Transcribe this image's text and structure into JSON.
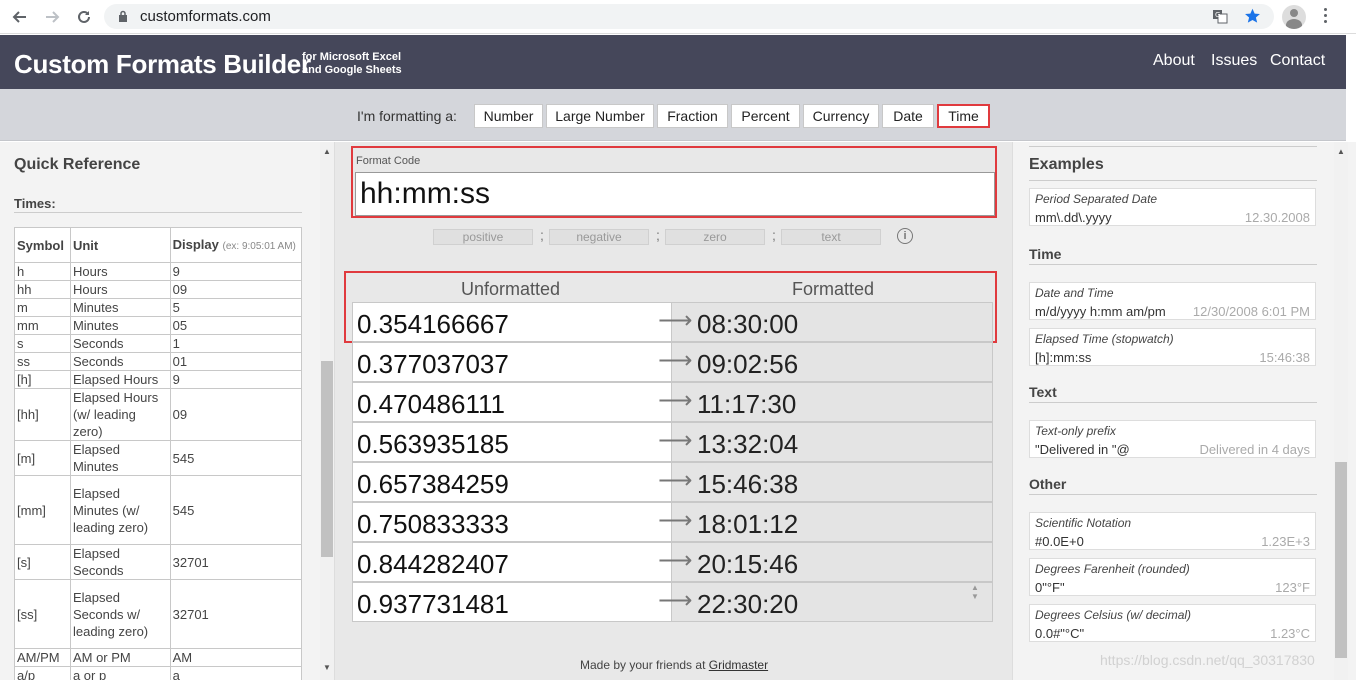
{
  "browser": {
    "url": "customformats.com",
    "icons": {
      "back": "back-arrow-icon",
      "forward": "forward-arrow-icon",
      "reload": "reload-icon",
      "lock": "lock-icon",
      "translate": "translate-icon",
      "bookmark": "star-icon",
      "profile": "avatar-icon",
      "menu": "kebab-menu-icon"
    }
  },
  "header": {
    "brand": "Custom Formats Builder",
    "subtitle_line1": "for Microsoft Excel",
    "subtitle_line2": "and Google Sheets",
    "nav": [
      "About",
      "Issues",
      "Contact"
    ]
  },
  "type_bar": {
    "label": "I'm formatting a:",
    "options": [
      "Number",
      "Large Number",
      "Fraction",
      "Percent",
      "Currency",
      "Date",
      "Time"
    ],
    "selected": "Time"
  },
  "quick_reference": {
    "title": "Quick Reference",
    "section": "Times:",
    "columns": [
      "Symbol",
      "Unit",
      "Display"
    ],
    "display_hint": "(ex: 9:05:01 AM)",
    "rows": [
      [
        "h",
        "Hours",
        "9"
      ],
      [
        "hh",
        "Hours",
        "09"
      ],
      [
        "m",
        "Minutes",
        "5"
      ],
      [
        "mm",
        "Minutes",
        "05"
      ],
      [
        "s",
        "Seconds",
        "1"
      ],
      [
        "ss",
        "Seconds",
        "01"
      ],
      [
        "[h]",
        "Elapsed Hours",
        "9"
      ],
      [
        "[hh]",
        "Elapsed Hours (w/ leading zero)",
        "09"
      ],
      [
        "[m]",
        "Elapsed Minutes",
        "545"
      ],
      [
        "[mm]",
        "Elapsed Minutes (w/ leading zero)",
        "545"
      ],
      [
        "[s]",
        "Elapsed Seconds",
        "32701"
      ],
      [
        "[ss]",
        "Elapsed Seconds w/ leading zero)",
        "32701"
      ],
      [
        "AM/PM",
        "AM or PM",
        "AM"
      ],
      [
        "a/p",
        "a or p",
        "a"
      ]
    ]
  },
  "format_code": {
    "label": "Format Code",
    "value": "hh:mm:ss",
    "sections": [
      "positive",
      "negative",
      "zero",
      "text"
    ],
    "separator": ";"
  },
  "conversion": {
    "headers": [
      "Unformatted",
      "Formatted"
    ],
    "rows": [
      [
        "0.354166667",
        "08:30:00"
      ],
      [
        "0.377037037",
        "09:02:56"
      ],
      [
        "0.470486111",
        "11:17:30"
      ],
      [
        "0.563935185",
        "13:32:04"
      ],
      [
        "0.657384259",
        "15:46:38"
      ],
      [
        "0.750833333",
        "18:01:12"
      ],
      [
        "0.844282407",
        "20:15:46"
      ],
      [
        "0.937731481",
        "22:30:20"
      ]
    ]
  },
  "footer": {
    "text": "Made by your friends at",
    "link": "Gridmaster"
  },
  "examples": {
    "title": "Examples",
    "groups": [
      {
        "name": "",
        "items": [
          {
            "name": "Period Separated Date",
            "code": "mm\\.dd\\.yyyy",
            "result": "12.30.2008"
          }
        ]
      },
      {
        "name": "Time",
        "items": [
          {
            "name": "Date and Time",
            "code": "m/d/yyyy h:mm am/pm",
            "result": "12/30/2008 6:01 PM"
          },
          {
            "name": "Elapsed Time (stopwatch)",
            "code": "[h]:mm:ss",
            "result": "15:46:38"
          }
        ]
      },
      {
        "name": "Text",
        "items": [
          {
            "name": "Text-only prefix",
            "code": "\"Delivered in \"@",
            "result": "Delivered in 4 days"
          }
        ]
      },
      {
        "name": "Other",
        "items": [
          {
            "name": "Scientific Notation",
            "code": "#0.0E+0",
            "result": "1.23E+3"
          },
          {
            "name": "Degrees Farenheit (rounded)",
            "code": "0\"°F\"",
            "result": "123°F"
          },
          {
            "name": "Degrees Celsius (w/ decimal)",
            "code": "0.0#\"°C\"",
            "result": "1.23°C"
          }
        ]
      }
    ]
  },
  "watermark": "https://blog.csdn.net/qq_30317830",
  "colors": {
    "header_bg": "#45475a",
    "highlight": "#e03a3e",
    "bookmark_star": "#1a73e8"
  }
}
